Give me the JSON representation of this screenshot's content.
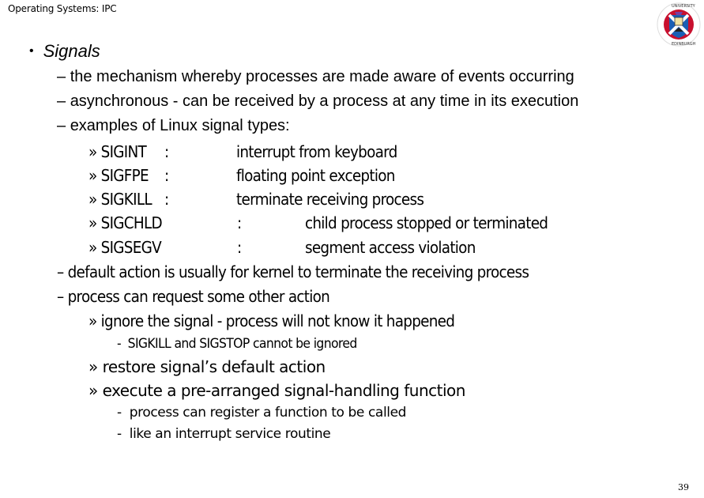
{
  "header": {
    "title": "Operating Systems: IPC"
  },
  "logo": {
    "name": "University of Edinburgh crest",
    "ring_text": "THE UNIVERSITY OF EDINBURGH",
    "colors": {
      "ring": "#c8102e",
      "saltire": "#1a5fb4",
      "field": "#ffffff"
    }
  },
  "slide": {
    "heading_bullet": "•",
    "heading": "Signals",
    "points": [
      {
        "marker": "–",
        "text": "the mechanism whereby processes are made aware of events occurring"
      },
      {
        "marker": "–",
        "text": "asynchronous - can be received by a process at any time in its execution"
      },
      {
        "marker": "–",
        "text": "examples of Linux signal types:"
      }
    ],
    "signals": [
      {
        "marker": "»",
        "name": "SIGINT",
        "colon": ":",
        "description": "interrupt from keyboard"
      },
      {
        "marker": "»",
        "name": "SIGFPE",
        "colon": ":",
        "description": "floating point exception"
      },
      {
        "marker": "»",
        "name": "SIGKILL",
        "colon": ":",
        "description": "terminate receiving process"
      },
      {
        "marker": "»",
        "name": "SIGCHLD",
        "colon": ":",
        "description": "child process stopped or terminated"
      },
      {
        "marker": "»",
        "name": "SIGSEGV",
        "colon": ":",
        "description": "segment access violation"
      }
    ],
    "points2": [
      {
        "marker": "–",
        "text": "default action is usually for kernel to terminate the receiving process"
      },
      {
        "marker": "–",
        "text": "process can request some other action"
      }
    ],
    "actions": [
      {
        "marker": "»",
        "text": "ignore the signal - process will not know it happened",
        "notes": [
          {
            "marker": "-",
            "text": "SIGKILL and SIGSTOP cannot be ignored"
          }
        ]
      },
      {
        "marker": "»",
        "text": "restore signal’s default action",
        "notes": []
      },
      {
        "marker": "»",
        "text": "execute a pre-arranged signal-handling function",
        "notes": [
          {
            "marker": "-",
            "text": "process can register a function to be called"
          },
          {
            "marker": "-",
            "text": "like an interrupt service routine"
          }
        ]
      }
    ]
  },
  "footer": {
    "page_number": "39"
  }
}
